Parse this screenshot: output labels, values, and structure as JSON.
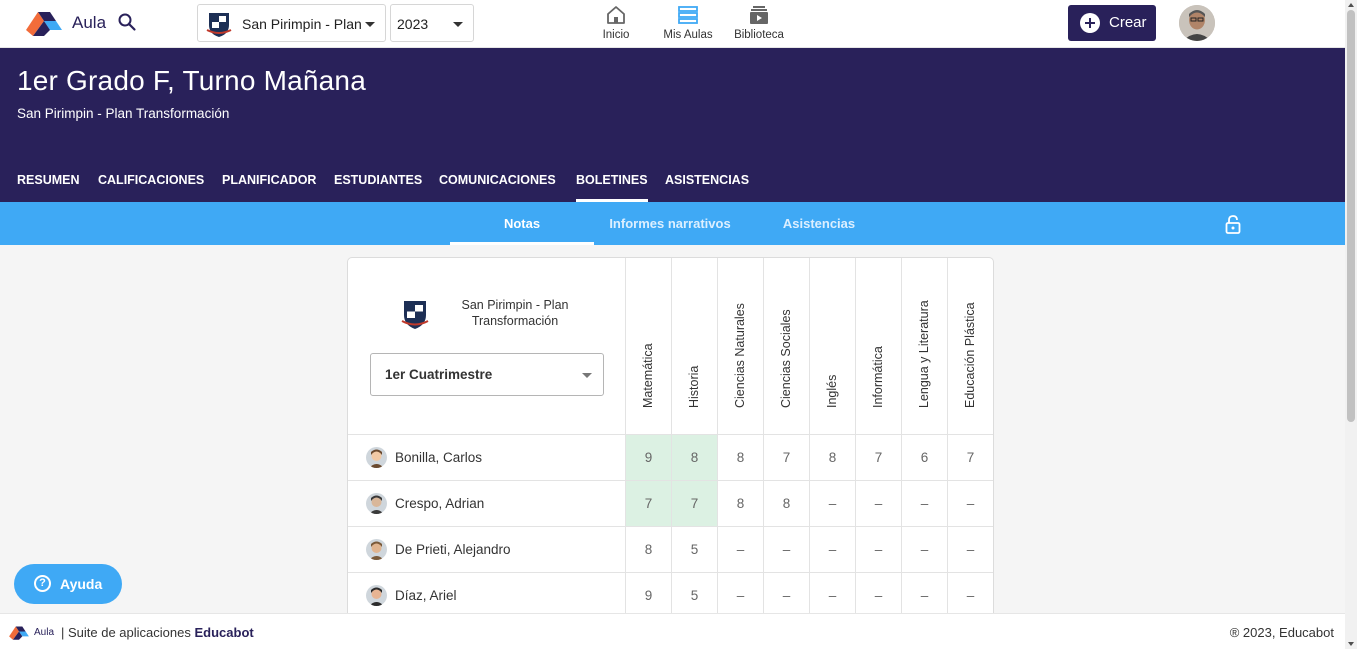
{
  "topbar": {
    "app_name": "Aula",
    "school_select_value": "San Pirimpin - Plan Transformación",
    "year_select_value": "2023",
    "nav": [
      {
        "label": "Inicio",
        "icon": "home-icon"
      },
      {
        "label": "Mis Aulas",
        "icon": "classrooms-icon"
      },
      {
        "label": "Biblioteca",
        "icon": "library-icon"
      }
    ],
    "create_label": "Crear"
  },
  "course": {
    "title": "1er Grado F, Turno Mañana",
    "school": "San Pirimpin - Plan Transformación"
  },
  "tabs": [
    {
      "label": "RESUMEN",
      "active": false
    },
    {
      "label": "CALIFICACIONES",
      "active": false
    },
    {
      "label": "PLANIFICADOR",
      "active": false
    },
    {
      "label": "ESTUDIANTES",
      "active": false
    },
    {
      "label": "COMUNICACIONES",
      "active": false
    },
    {
      "label": "BOLETINES",
      "active": true
    },
    {
      "label": "ASISTENCIAS",
      "active": false
    }
  ],
  "subtabs": [
    {
      "label": "Notas",
      "active": true
    },
    {
      "label": "Informes narrativos",
      "active": false
    },
    {
      "label": "Asistencias",
      "active": false
    }
  ],
  "report": {
    "school_name": "San Pirimpin  - Plan Transformación",
    "period_value": "1er Cuatrimestre",
    "subjects": [
      "Matemática",
      "Historia",
      "Ciencias Naturales",
      "Ciencias Sociales",
      "Inglés",
      "Informática",
      "Lengua y Literatura",
      "Educación Plástica"
    ],
    "students": [
      {
        "name": "Bonilla, Carlos",
        "grades": [
          "9",
          "8",
          "8",
          "7",
          "8",
          "7",
          "6",
          "7"
        ],
        "highlighted": [
          0,
          1
        ]
      },
      {
        "name": "Crespo, Adrian",
        "grades": [
          "7",
          "7",
          "8",
          "8",
          "–",
          "–",
          "–",
          "–"
        ],
        "highlighted": [
          0,
          1
        ]
      },
      {
        "name": "De Prieti, Alejandro",
        "grades": [
          "8",
          "5",
          "–",
          "–",
          "–",
          "–",
          "–",
          "–"
        ],
        "highlighted": []
      },
      {
        "name": "Díaz, Ariel",
        "grades": [
          "9",
          "5",
          "–",
          "–",
          "–",
          "–",
          "–",
          "–"
        ],
        "highlighted": []
      }
    ]
  },
  "help_label": "Ayuda",
  "footer": {
    "app": "Aula",
    "suite_text": "| Suite de aplicaciones",
    "brand": "Educabot",
    "copyright": "® 2023, Educabot"
  },
  "colors": {
    "primary": "#29215a",
    "accent": "#3fa9f5",
    "highlight": "#dcf1e3"
  }
}
